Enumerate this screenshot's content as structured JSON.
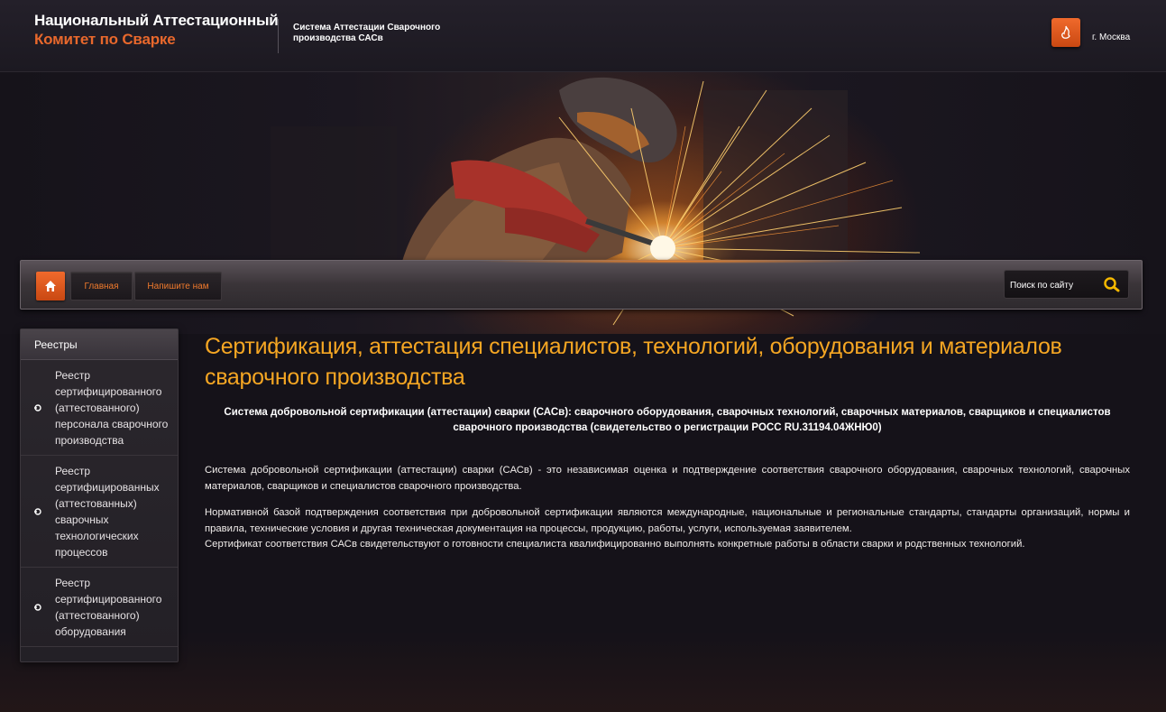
{
  "header": {
    "logo_line1": "Национальный Аттестационный",
    "logo_line2": "Комитет по Сварке",
    "tagline": "Система Аттестации Сварочного производства САСв",
    "city": "г. Москва"
  },
  "nav": {
    "main_label": "Главная",
    "write_label": "Напишите нам",
    "search_placeholder": "Поиск по сайту"
  },
  "sidebar": {
    "title": "Реестры",
    "items": [
      {
        "label": "Реестр сертифицированного (аттестованного) персонала сварочного производства"
      },
      {
        "label": "Реестр сертифицированных (аттестованных) сварочных технологических процессов"
      },
      {
        "label": "Реестр сертифицированного (аттестованного) оборудования"
      }
    ]
  },
  "content": {
    "title": "Сертификация, аттестация специалистов, технологий, оборудования и материалов сварочного производства",
    "subtitle": "Система добровольной сертификации (аттестации) сварки (САСв): сварочного оборудования, сварочных технологий, сварочных материалов, сварщиков и специалистов сварочного производства (свидетельство о регистрации РОСС RU.31194.04ЖНЮ0)",
    "paragraph1": "Система добровольной сертификации (аттестации) сварки (САСв) - это независимая оценка и подтверждение соответствия сварочного оборудования, сварочных технологий, сварочных материалов, сварщиков и специалистов сварочного производства.",
    "paragraph2": "Нормативной базой подтверждения соответствия при добровольной сертификации являются международные, национальные и региональные стандарты, стандарты организаций, нормы и правила, технические условия и другая техническая документация на процессы, продукцию, работы, услуги, используемая заявителем.",
    "paragraph3": "Сертификат соответствия САСв свидетельствуют о готовности специалиста квалифицированно выполнять конкретные работы в области сварки и родственных технологий."
  },
  "colors": {
    "accent_orange": "#e8682c",
    "title_gold": "#f5a623",
    "background": "#151219"
  },
  "icons": {
    "flame": "flame-icon",
    "home": "home-icon",
    "search": "search-icon",
    "bullet": "bullet-icon"
  }
}
